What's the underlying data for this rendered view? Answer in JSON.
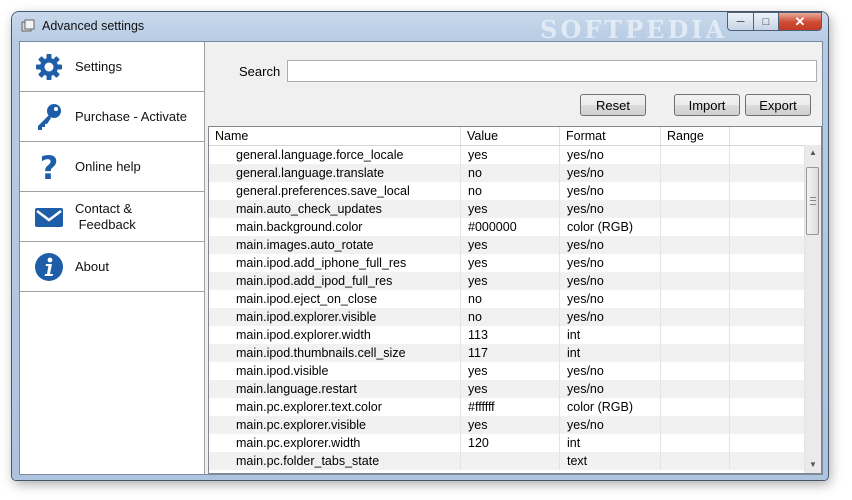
{
  "window": {
    "title": "Advanced settings",
    "watermark": "SOFTPEDIA"
  },
  "sidebar": {
    "items": [
      {
        "label": "Settings",
        "icon": "gear-icon"
      },
      {
        "label": "Purchase - Activate",
        "icon": "key-icon"
      },
      {
        "label": "Online help",
        "icon": "question-icon"
      },
      {
        "label": "Contact &",
        "label2": " Feedback",
        "icon": "mail-icon"
      },
      {
        "label": "About",
        "icon": "info-icon"
      }
    ]
  },
  "search": {
    "label": "Search",
    "value": ""
  },
  "toolbar": {
    "reset": "Reset",
    "import": "Import",
    "export": "Export"
  },
  "table": {
    "columns": [
      "Name",
      "Value",
      "Format",
      "Range"
    ],
    "rows": [
      {
        "name": "general.language.force_locale",
        "value": "yes",
        "format": "yes/no"
      },
      {
        "name": "general.language.translate",
        "value": "no",
        "format": "yes/no"
      },
      {
        "name": "general.preferences.save_local",
        "value": "no",
        "format": "yes/no"
      },
      {
        "name": "main.auto_check_updates",
        "value": "yes",
        "format": "yes/no"
      },
      {
        "name": "main.background.color",
        "value": "#000000",
        "format": "color (RGB)"
      },
      {
        "name": "main.images.auto_rotate",
        "value": "yes",
        "format": "yes/no"
      },
      {
        "name": "main.ipod.add_iphone_full_res",
        "value": "yes",
        "format": "yes/no"
      },
      {
        "name": "main.ipod.add_ipod_full_res",
        "value": "yes",
        "format": "yes/no"
      },
      {
        "name": "main.ipod.eject_on_close",
        "value": "no",
        "format": "yes/no"
      },
      {
        "name": "main.ipod.explorer.visible",
        "value": "no",
        "format": "yes/no"
      },
      {
        "name": "main.ipod.explorer.width",
        "value": "113",
        "format": "int"
      },
      {
        "name": "main.ipod.thumbnails.cell_size",
        "value": "117",
        "format": "int"
      },
      {
        "name": "main.ipod.visible",
        "value": "yes",
        "format": "yes/no"
      },
      {
        "name": "main.language.restart",
        "value": "yes",
        "format": "yes/no"
      },
      {
        "name": "main.pc.explorer.text.color",
        "value": "#ffffff",
        "format": "color (RGB)"
      },
      {
        "name": "main.pc.explorer.visible",
        "value": "yes",
        "format": "yes/no"
      },
      {
        "name": "main.pc.explorer.width",
        "value": "120",
        "format": "int"
      },
      {
        "name": "main.pc.folder_tabs_state",
        "value": "",
        "format": "text"
      }
    ]
  },
  "colors": {
    "accent_blue": "#1e5ea8",
    "close_red": "#c23a23",
    "row_alt": "#f1f1f1"
  }
}
